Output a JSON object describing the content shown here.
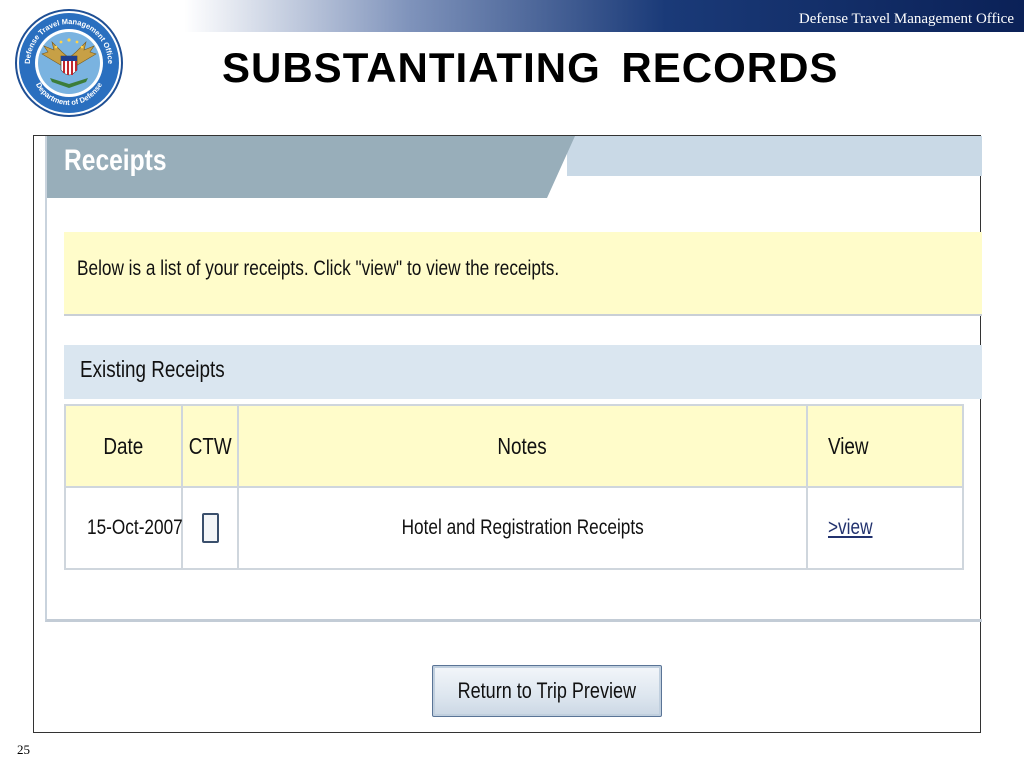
{
  "slide": {
    "org_name": "Defense Travel Management Office",
    "title": "SUBSTANTIATING  RECORDS",
    "page_number": "25",
    "seal": {
      "icon": "dtmo-seal-icon",
      "top_text": "Defense Travel Management Office",
      "bottom_text": "Department of Defense"
    }
  },
  "receipts": {
    "title": "Receipts",
    "info_text": "Below is a list of your receipts. Click \"view\" to view the receipts.",
    "existing_label": "Existing Receipts",
    "columns": [
      "Date",
      "CTW",
      "Notes",
      "View"
    ],
    "rows": [
      {
        "date": "15-Oct-2007",
        "ctw": false,
        "notes": "Hotel and Registration Receipts",
        "view": ">view"
      }
    ],
    "return_button": "Return to Trip Preview"
  },
  "colors": {
    "header_navy": "#0b2157",
    "tab_gray_blue": "#98aeba",
    "info_yellow": "#fffcca",
    "section_blue": "#dae6f0",
    "link_blue": "#22326e"
  }
}
